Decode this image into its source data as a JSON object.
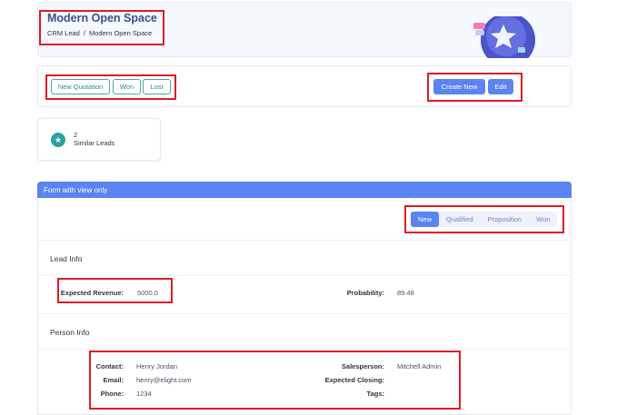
{
  "header": {
    "title": "Modern Open Space",
    "breadcrumb": [
      "CRM Lead",
      "Modern Open Space"
    ],
    "breadcrumb_separator": "/",
    "illustration_icon": "star-badge-icon"
  },
  "actions": {
    "left": [
      "New Quotation",
      "Won",
      "Lost"
    ],
    "right": [
      "Create New",
      "Edit"
    ]
  },
  "similar": {
    "count": "2",
    "label": "Similar Leads",
    "icon": "star-icon"
  },
  "form": {
    "header": "Form with view only",
    "stages": [
      {
        "label": "New",
        "active": true
      },
      {
        "label": "Qualified",
        "active": false
      },
      {
        "label": "Proposition",
        "active": false
      },
      {
        "label": "Won",
        "active": false
      }
    ],
    "lead_info": {
      "title": "Lead Info",
      "expected_revenue_label": "Expected Revenue:",
      "expected_revenue": "5000.0",
      "probability_label": "Probability:",
      "probability": "89.48"
    },
    "person_info": {
      "title": "Person Info",
      "contact_label": "Contact:",
      "contact": "Henry Jordan",
      "email_label": "Email:",
      "email": "henry@elight.com",
      "phone_label": "Phone:",
      "phone": "1234",
      "salesperson_label": "Salesperson:",
      "salesperson": "Mitchell Admin",
      "expected_closing_label": "Expected Closing:",
      "expected_closing": "",
      "tags_label": "Tags:",
      "tags": ""
    }
  },
  "colors": {
    "accent": "#5b84f0",
    "teal": "#2aa3a0",
    "highlight": "#e01b24"
  }
}
